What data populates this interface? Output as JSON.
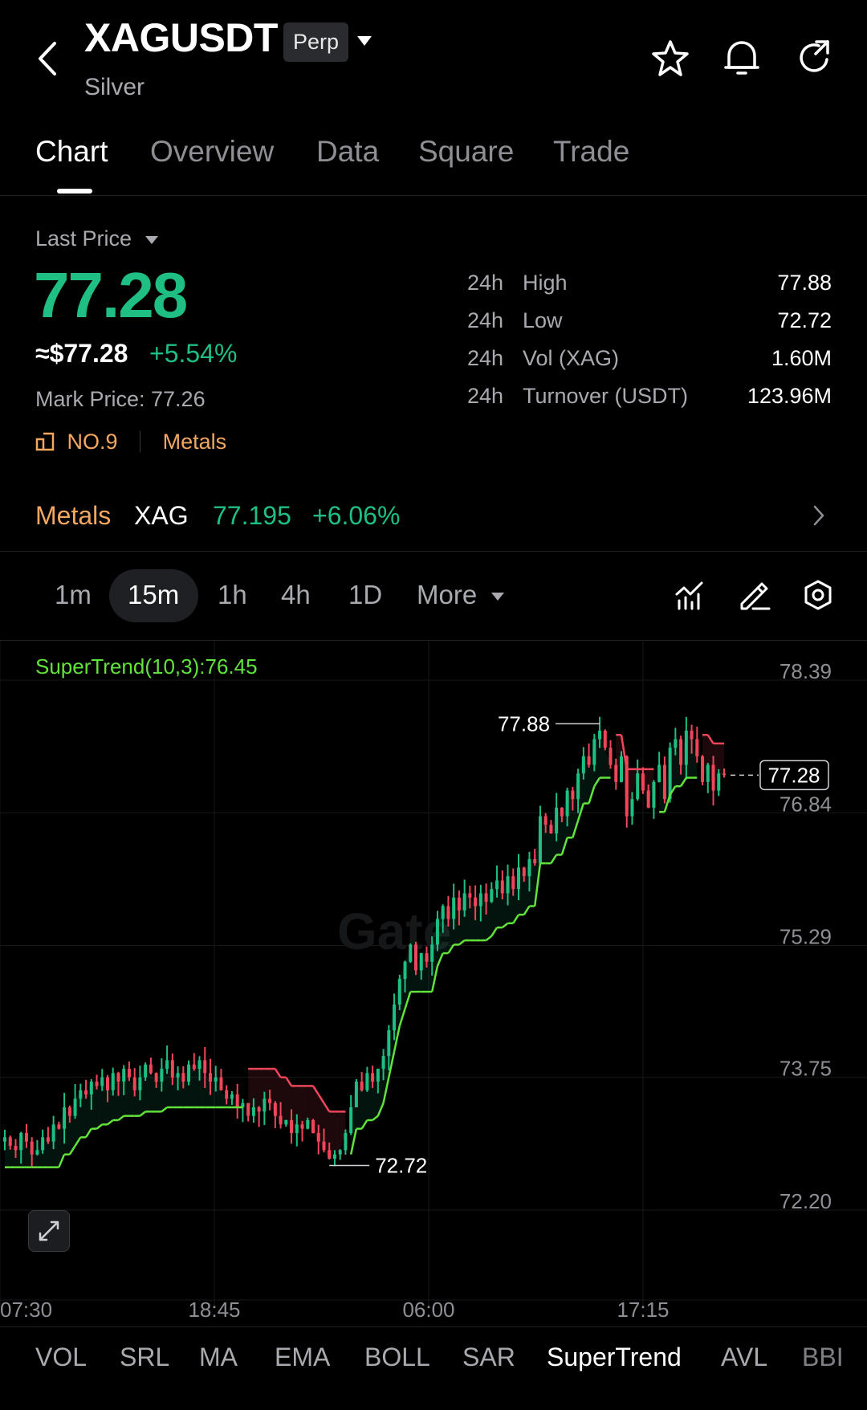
{
  "header": {
    "symbol": "XAGUSDT",
    "contract_type": "Perp",
    "name": "Silver"
  },
  "tabs": [
    {
      "label": "Chart",
      "active": true
    },
    {
      "label": "Overview",
      "active": false
    },
    {
      "label": "Data",
      "active": false
    },
    {
      "label": "Square",
      "active": false
    },
    {
      "label": "Trade",
      "active": false
    }
  ],
  "price": {
    "label": "Last Price",
    "last": "77.28",
    "approx_usd": "≈$77.28",
    "change_pct": "+5.54%",
    "mark_price": "Mark Price: 77.26",
    "rank": "NO.9",
    "category": "Metals"
  },
  "stats": [
    {
      "period": "24h",
      "name": "High",
      "value": "77.88"
    },
    {
      "period": "24h",
      "name": "Low",
      "value": "72.72"
    },
    {
      "period": "24h",
      "name": "Vol (XAG)",
      "value": "1.60M"
    },
    {
      "period": "24h",
      "name": "Turnover (USDT)",
      "value": "123.96M"
    }
  ],
  "metals_strip": {
    "label": "Metals",
    "symbol": "XAG",
    "price": "77.195",
    "change_pct": "+6.06%"
  },
  "intervals": [
    {
      "label": "1m",
      "active": false
    },
    {
      "label": "15m",
      "active": true
    },
    {
      "label": "1h",
      "active": false
    },
    {
      "label": "4h",
      "active": false
    },
    {
      "label": "1D",
      "active": false
    },
    {
      "label": "More",
      "active": false
    }
  ],
  "indicators": [
    "VOL",
    "SRL",
    "MA",
    "EMA",
    "BOLL",
    "SAR",
    "SuperTrend",
    "AVL",
    "BBI"
  ],
  "active_indicator": "SuperTrend",
  "colors": {
    "up": "#1fbf84",
    "down": "#f0465b",
    "accent": "#f3a761",
    "supertrend_up": "#62e33b",
    "supertrend_down": "#f0465b"
  },
  "chart_data": {
    "type": "candlestick",
    "indicator_label": "SuperTrend(10,3):76.45",
    "y_ticks": [
      "78.39",
      "76.84",
      "75.29",
      "73.75",
      "72.20"
    ],
    "ylim": [
      72.2,
      78.39
    ],
    "x_ticks": [
      "07:30",
      "18:45",
      "06:00",
      "17:15"
    ],
    "current_price_label": "77.28",
    "high_label": "77.88",
    "low_label": "72.72",
    "watermark": "Gate",
    "close_series": [
      73.05,
      72.95,
      72.9,
      73.1,
      73.0,
      72.85,
      72.9,
      73.05,
      73.0,
      73.2,
      73.15,
      73.4,
      73.3,
      73.5,
      73.6,
      73.55,
      73.7,
      73.65,
      73.75,
      73.6,
      73.8,
      73.7,
      73.85,
      73.75,
      73.6,
      73.75,
      73.9,
      73.8,
      73.7,
      73.85,
      73.95,
      73.75,
      73.8,
      73.7,
      73.9,
      73.85,
      73.95,
      73.8,
      73.7,
      73.75,
      73.6,
      73.5,
      73.55,
      73.4,
      73.45,
      73.3,
      73.4,
      73.35,
      73.5,
      73.45,
      73.3,
      73.2,
      73.25,
      73.1,
      73.2,
      73.15,
      73.25,
      73.1,
      73.0,
      72.9,
      72.8,
      72.85,
      72.9,
      73.1,
      73.4,
      73.7,
      73.6,
      73.8,
      73.7,
      73.85,
      74.0,
      74.3,
      74.6,
      74.9,
      75.1,
      75.3,
      75.0,
      75.2,
      75.1,
      75.3,
      75.6,
      75.75,
      75.6,
      75.85,
      75.7,
      75.9,
      75.85,
      75.75,
      75.9,
      75.8,
      75.95,
      76.05,
      75.9,
      76.1,
      75.95,
      76.2,
      76.1,
      76.3,
      76.25,
      76.8,
      76.7,
      76.6,
      76.9,
      76.8,
      77.1,
      77.0,
      77.3,
      77.5,
      77.4,
      77.7,
      77.8,
      77.6,
      77.4,
      77.2,
      77.5,
      76.8,
      77.0,
      77.3,
      77.1,
      76.9,
      77.2,
      77.4,
      77.0,
      77.6,
      77.7,
      77.4,
      77.8,
      77.7,
      77.5,
      77.2,
      77.4,
      77.1,
      77.3,
      77.28
    ]
  }
}
